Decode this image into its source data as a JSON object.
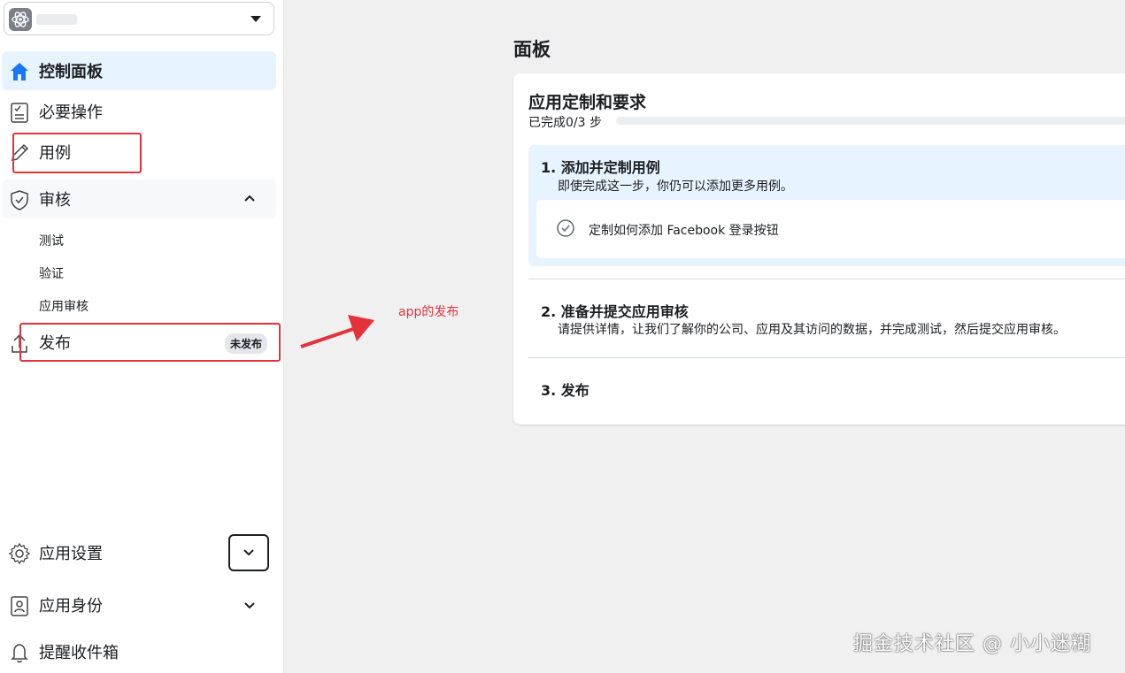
{
  "sidebar": {
    "app_selector": {
      "icon": "atom-icon"
    },
    "items": [
      {
        "label": "控制面板",
        "icon": "home-icon"
      },
      {
        "label": "必要操作",
        "icon": "checklist-icon"
      },
      {
        "label": "用例",
        "icon": "pencil-icon"
      },
      {
        "label": "审核",
        "icon": "shield-check-icon"
      },
      {
        "label": "发布",
        "icon": "upload-icon",
        "badge": "未发布"
      },
      {
        "label": "应用设置",
        "icon": "gear-icon"
      },
      {
        "label": "应用身份",
        "icon": "id-card-icon"
      },
      {
        "label": "提醒收件箱",
        "icon": "bell-icon"
      }
    ],
    "review_subitems": [
      "测试",
      "验证",
      "应用审核"
    ]
  },
  "annotation": {
    "arrow_label": "app的发布",
    "color": "#e5323a"
  },
  "main": {
    "page_title": "面板",
    "card": {
      "title": "应用定制和要求",
      "progress_text": "已完成0/3 步",
      "progress": 0,
      "steps": [
        {
          "title": "1. 添加并定制用例",
          "description": "即使完成这一步，你仍可以添加更多用例。",
          "task": "定制如何添加 Facebook 登录按钮"
        },
        {
          "title": "2. 准备并提交应用审核",
          "description": "请提供详情，让我们了解你的公司、应用及其访问的数据，并完成测试，然后提交应用审核。"
        },
        {
          "title": "3. 发布"
        }
      ]
    }
  },
  "watermark": "掘金技术社区 @ 小小迷糊",
  "colors": {
    "accent": "#1877f2",
    "active_bg": "#e7f3ff",
    "annotation": "#e5323a"
  }
}
